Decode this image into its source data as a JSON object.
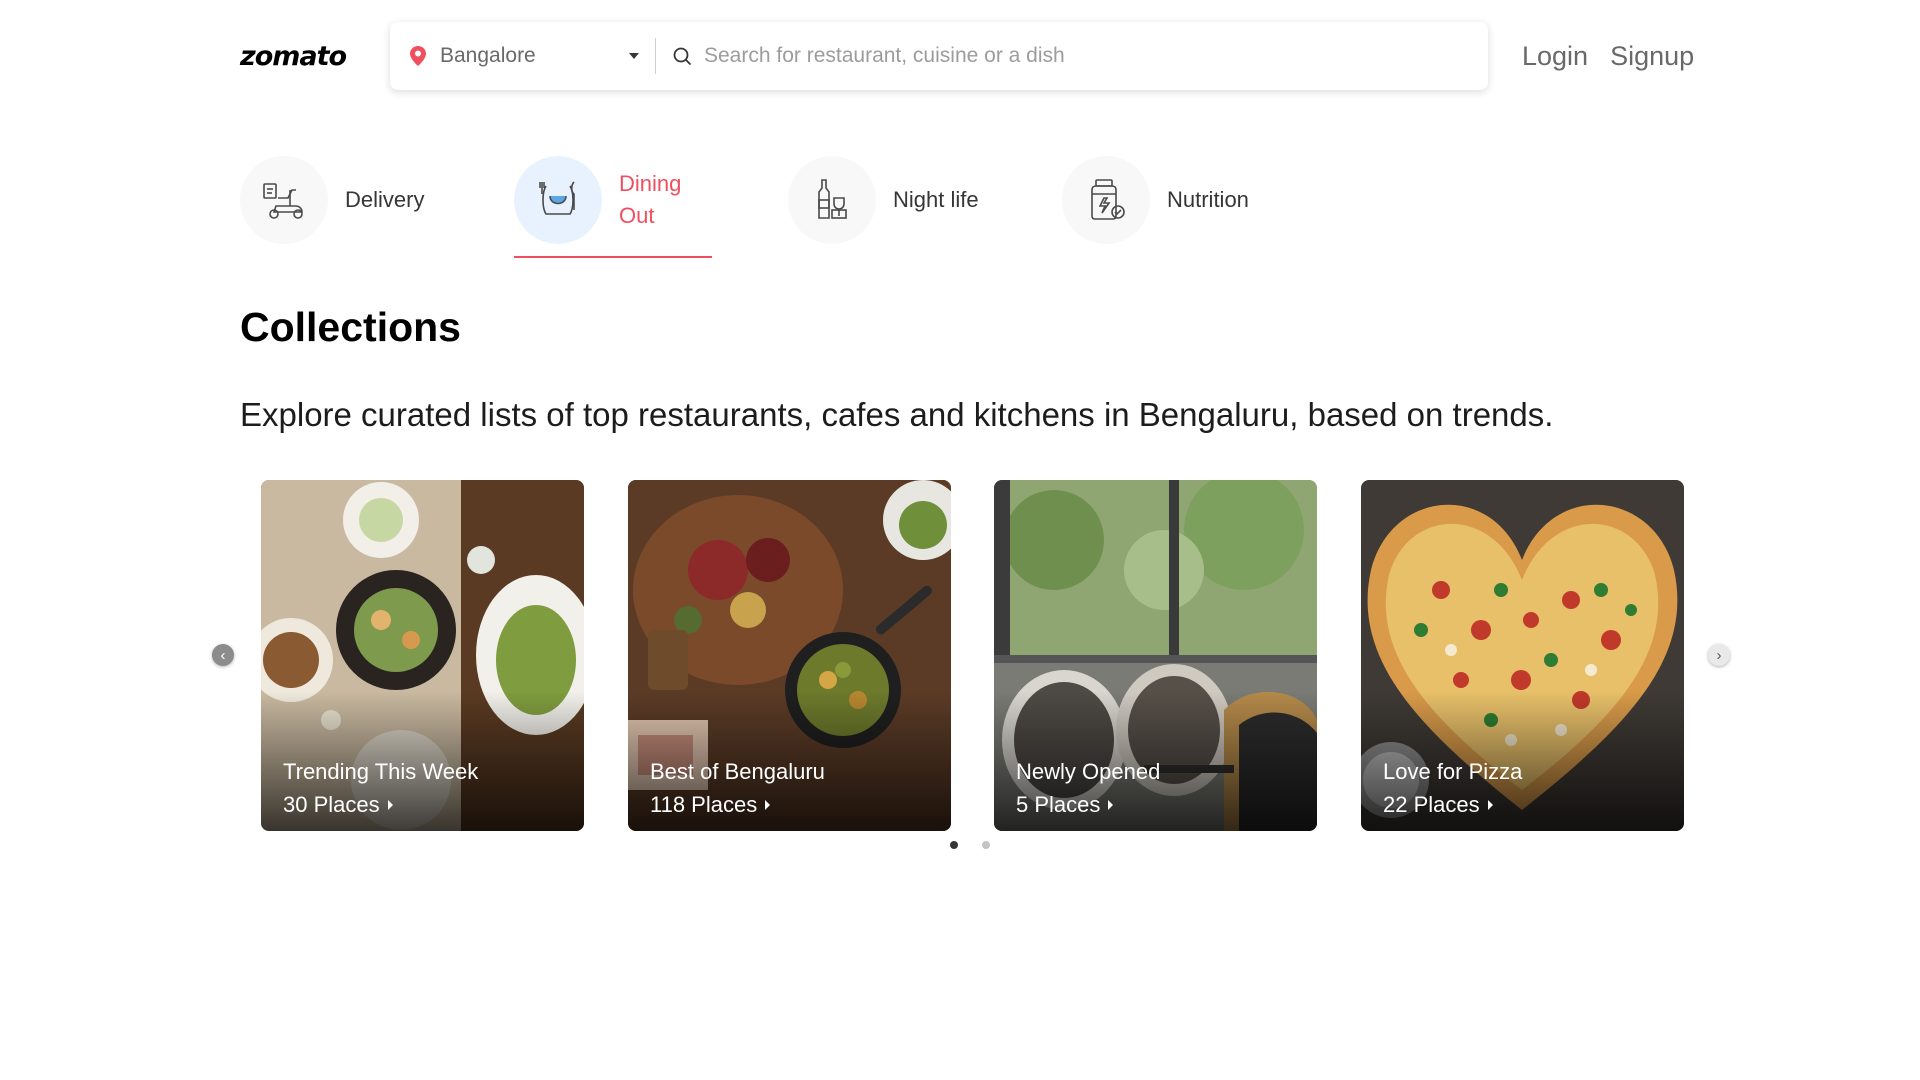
{
  "brand": {
    "logo_text": "zomato"
  },
  "search": {
    "location": "Bangalore",
    "placeholder": "Search for restaurant, cuisine or a dish"
  },
  "auth": {
    "login": "Login",
    "signup": "Signup"
  },
  "tabs": [
    {
      "label": "Delivery",
      "icon": "delivery-scooter-icon",
      "active": false
    },
    {
      "label": "Dining Out",
      "icon": "dining-plate-icon",
      "active": true
    },
    {
      "label": "Night life",
      "icon": "nightlife-bottle-icon",
      "active": false
    },
    {
      "label": "Nutrition",
      "icon": "nutrition-jar-icon",
      "active": false
    }
  ],
  "collections": {
    "title": "Collections",
    "subtitle": "Explore curated lists of top restaurants, cafes and kitchens in Bengaluru, based on trends.",
    "cards": [
      {
        "name": "Trending This Week",
        "count": "30 Places"
      },
      {
        "name": "Best of Bengaluru",
        "count": "118 Places"
      },
      {
        "name": "Newly Opened",
        "count": "5 Places"
      },
      {
        "name": "Love for Pizza",
        "count": "22 Places"
      }
    ],
    "page_dots": {
      "total": 2,
      "active": 1
    }
  },
  "colors": {
    "accent": "#ef4f5f",
    "active_tab_bg": "#e8f2ff",
    "text_muted": "#696969"
  }
}
